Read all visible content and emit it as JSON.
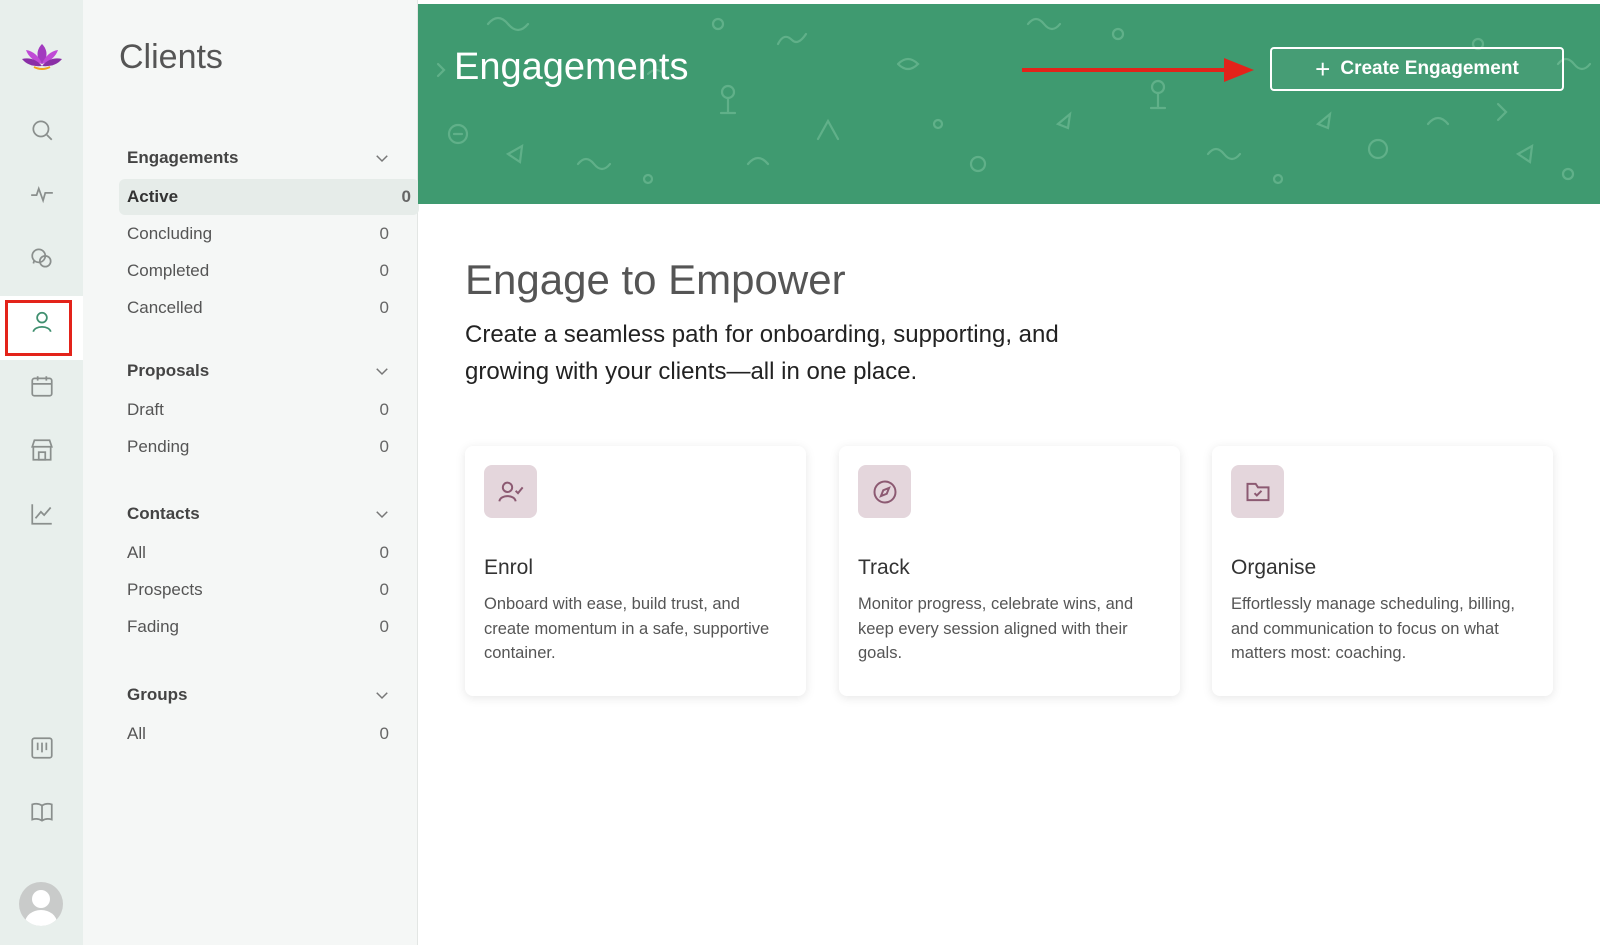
{
  "brand": {
    "logo_icon": "lotus-icon",
    "accent": "#3f9a70",
    "highlight": "#e3231a"
  },
  "rail": {
    "items": [
      {
        "icon": "search-icon"
      },
      {
        "icon": "activity-icon"
      },
      {
        "icon": "chat-icon"
      },
      {
        "icon": "user-icon",
        "active": true
      },
      {
        "icon": "calendar-icon"
      },
      {
        "icon": "store-icon"
      },
      {
        "icon": "chart-icon"
      },
      {
        "icon": "board-icon"
      },
      {
        "icon": "book-icon"
      }
    ],
    "avatar": "avatar"
  },
  "sidebar": {
    "title": "Clients",
    "engagements": {
      "label": "Engagements",
      "items": [
        {
          "label": "Active",
          "count": "0"
        },
        {
          "label": "Concluding",
          "count": "0"
        },
        {
          "label": "Completed",
          "count": "0"
        },
        {
          "label": "Cancelled",
          "count": "0"
        }
      ]
    },
    "proposals": {
      "label": "Proposals",
      "items": [
        {
          "label": "Draft",
          "count": "0"
        },
        {
          "label": "Pending",
          "count": "0"
        }
      ]
    },
    "contacts": {
      "label": "Contacts",
      "items": [
        {
          "label": "All",
          "count": "0"
        },
        {
          "label": "Prospects",
          "count": "0"
        },
        {
          "label": "Fading",
          "count": "0"
        }
      ]
    },
    "groups": {
      "label": "Groups",
      "items": [
        {
          "label": "All",
          "count": "0"
        }
      ]
    }
  },
  "banner": {
    "title": "Engagements",
    "create_button": "Create Engagement"
  },
  "main": {
    "headline": "Engage to Empower",
    "subline": "Create a seamless path for onboarding, supporting, and growing with your clients—all in one place.",
    "cards": [
      {
        "icon": "user-check-icon",
        "title": "Enrol",
        "desc": "Onboard with ease, build trust, and create momentum in a safe, supportive container."
      },
      {
        "icon": "compass-icon",
        "title": "Track",
        "desc": "Monitor progress, celebrate wins, and keep every session aligned with their goals."
      },
      {
        "icon": "folder-check-icon",
        "title": "Organise",
        "desc": "Effortlessly manage scheduling, billing, and communication to focus on what matters most: coaching."
      }
    ]
  }
}
